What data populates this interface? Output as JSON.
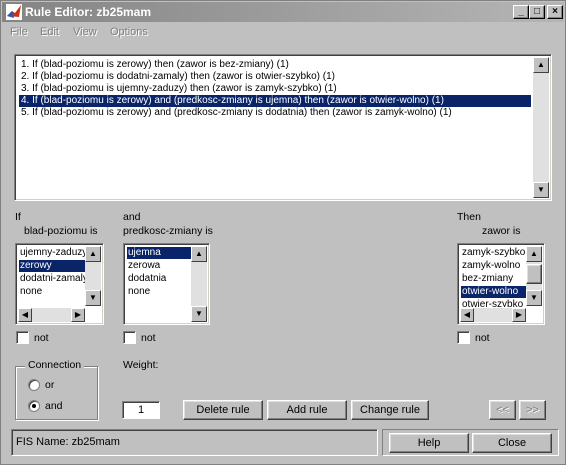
{
  "window": {
    "title": "Rule Editor: zb25mam"
  },
  "titlebar_buttons": {
    "minimize": "_",
    "maximize": "□",
    "close": "×"
  },
  "menu": [
    "File",
    "Edit",
    "View",
    "Options"
  ],
  "rules": [
    "1. If (blad-poziomu is zerowy) then (zawor is bez-zmiany) (1)",
    "2. If (blad-poziomu is dodatni-zamaly) then (zawor is otwier-szybko) (1)",
    "3. If (blad-poziomu is ujemny-zaduzy) then (zawor is zamyk-szybko) (1)",
    "4. If (blad-poziomu is zerowy) and (predkosc-zmiany is ujemna) then (zawor is otwier-wolno) (1)",
    "5. If (blad-poziomu is zerowy) and (predkosc-zmiany is dodatnia) then (zawor is zamyk-wolno) (1)"
  ],
  "selected_rule_index": 3,
  "input1": {
    "prefix": "If",
    "label": "blad-poziomu is",
    "options": [
      "ujemny-zaduzy",
      "zerowy",
      "dodatni-zamaly",
      "none"
    ],
    "selected": 1,
    "not_label": "not"
  },
  "input2": {
    "prefix": "and",
    "label": "predkosc-zmiany is",
    "options": [
      "ujemna",
      "zerowa",
      "dodatnia",
      "none"
    ],
    "selected": 0,
    "not_label": "not"
  },
  "output": {
    "prefix": "Then",
    "label": "zawor is",
    "options": [
      "zamyk-szybko",
      "zamyk-wolno",
      "bez-zmiany",
      "otwier-wolno",
      "otwier-szybko"
    ],
    "selected": 3,
    "not_label": "not"
  },
  "connection": {
    "title": "Connection",
    "options": [
      "or",
      "and"
    ],
    "selected": "and"
  },
  "weight": {
    "label": "Weight:",
    "value": "1"
  },
  "buttons": {
    "delete_rule": "Delete rule",
    "add_rule": "Add rule",
    "change_rule": "Change rule",
    "prev": "<<",
    "next": ">>",
    "help": "Help",
    "close": "Close"
  },
  "status": {
    "text": "FIS Name: zb25mam"
  },
  "colors": {
    "titlebar": "#848484",
    "selection": "#0a246a",
    "face": "#c0c0c0"
  }
}
